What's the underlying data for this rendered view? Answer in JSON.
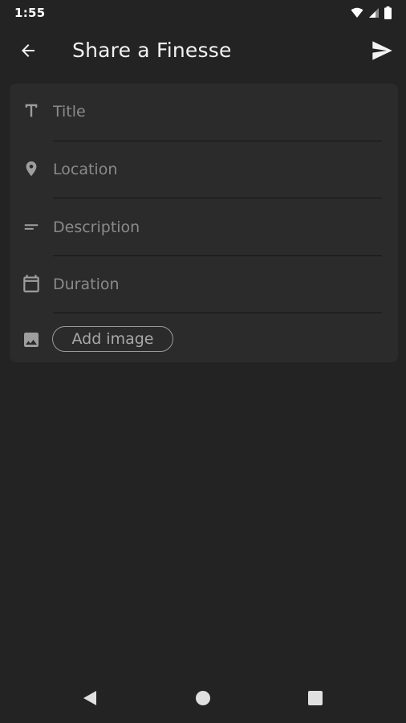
{
  "status_bar": {
    "time": "1:55",
    "icons": [
      "wifi-icon",
      "signal-icon",
      "battery-icon"
    ]
  },
  "app_bar": {
    "title": "Share a Finesse",
    "back_icon": "arrow-back-icon",
    "send_icon": "send-icon"
  },
  "form": {
    "title": {
      "placeholder": "Title",
      "value": "",
      "icon": "title-text-icon"
    },
    "location": {
      "placeholder": "Location",
      "value": "",
      "icon": "location-pin-icon"
    },
    "description": {
      "placeholder": "Description",
      "value": "",
      "icon": "short-text-icon"
    },
    "duration": {
      "placeholder": "Duration",
      "value": "",
      "icon": "calendar-icon"
    },
    "image": {
      "button_label": "Add image",
      "icon": "image-icon"
    }
  },
  "nav_bar": {
    "icons": [
      "nav-back-icon",
      "nav-home-icon",
      "nav-recents-icon"
    ]
  },
  "colors": {
    "background": "#232323",
    "card": "#2b2b2b",
    "text_primary": "#f2f2f2",
    "placeholder": "#8a8a8a",
    "icon": "#9e9e9e"
  }
}
